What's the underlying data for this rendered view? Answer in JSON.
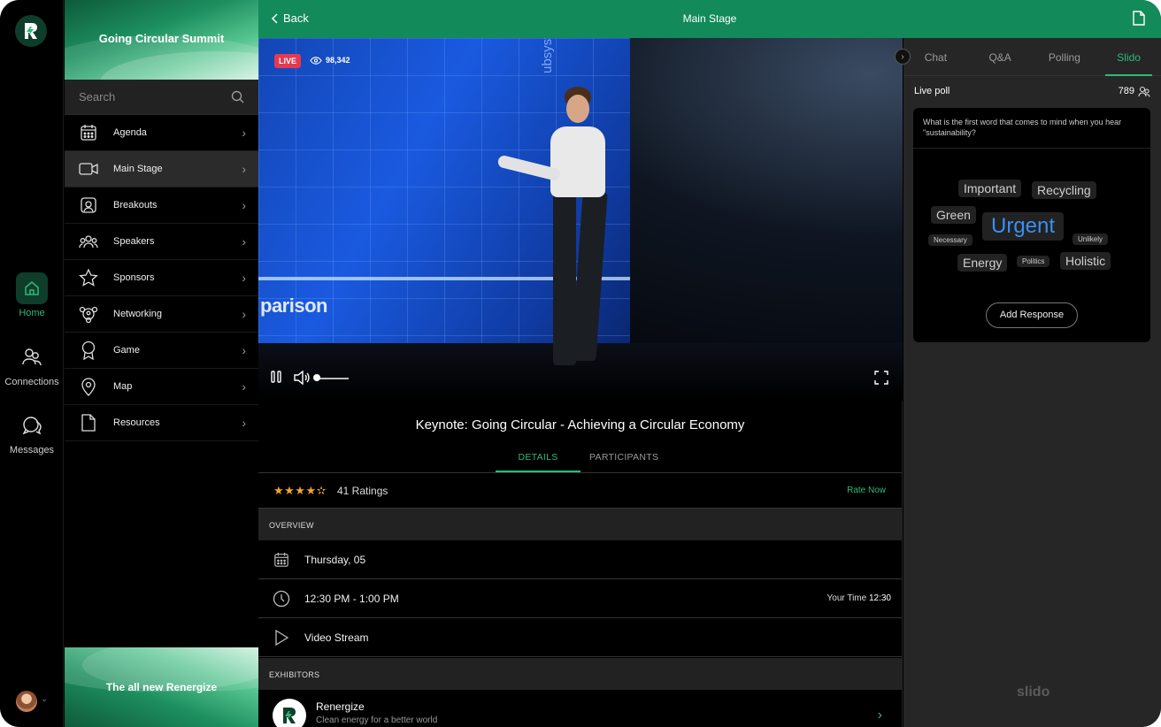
{
  "app": {
    "event_title": "Going Circular Summit",
    "promo_title": "The all new Renergize"
  },
  "rail": {
    "items": [
      {
        "label": "Home",
        "icon": "home-icon",
        "active": true
      },
      {
        "label": "Connections",
        "icon": "people-icon",
        "active": false
      },
      {
        "label": "Messages",
        "icon": "chat-icon",
        "active": false
      }
    ]
  },
  "nav": {
    "search_placeholder": "Search",
    "items": [
      {
        "label": "Agenda",
        "icon": "calendar-icon"
      },
      {
        "label": "Main Stage",
        "icon": "video-icon",
        "active": true
      },
      {
        "label": "Breakouts",
        "icon": "breakout-icon"
      },
      {
        "label": "Speakers",
        "icon": "speakers-icon"
      },
      {
        "label": "Sponsors",
        "icon": "star-icon"
      },
      {
        "label": "Networking",
        "icon": "network-icon"
      },
      {
        "label": "Game",
        "icon": "award-icon"
      },
      {
        "label": "Map",
        "icon": "map-pin-icon"
      },
      {
        "label": "Resources",
        "icon": "document-icon"
      }
    ]
  },
  "header": {
    "back_label": "Back",
    "title": "Main Stage"
  },
  "video": {
    "live_label": "LIVE",
    "viewers": "98,342",
    "screen_word": "parison",
    "screen_vertical": "ubsystem",
    "volume_level": 0.05
  },
  "session": {
    "title": "Keynote: Going Circular - Achieving a Circular Economy",
    "tabs": [
      "DETAILS",
      "PARTICIPANTS"
    ],
    "stars": "★★★★✫",
    "rating_value": 4.5,
    "ratings_label": "41 Ratings",
    "rate_now": "Rate Now",
    "overview_header": "OVERVIEW",
    "date": "Thursday, 05",
    "time": "12:30 PM - 1:00 PM",
    "your_time_label": "Your Time",
    "your_time_value": "12:30",
    "stream": "Video Stream",
    "exhibitors_header": "EXHIBITORS",
    "exhibitor_name": "Renergize",
    "exhibitor_tagline": "Clean energy for a better world"
  },
  "slido": {
    "tabs": [
      "Chat",
      "Q&A",
      "Polling",
      "Slido"
    ],
    "active_tab": "Slido",
    "live_poll_label": "Live poll",
    "participants": "789",
    "question": "What is the first word that comes to mind when you hear \"sustainability?",
    "words": [
      "Important",
      "Recycling",
      "Green",
      "Urgent",
      "Necessary",
      "Unlikely",
      "Energy",
      "Politics",
      "Holistic"
    ],
    "add_response": "Add Response",
    "brand": "slido",
    "accent_color": "#2fb87a",
    "highlight_color": "#3b8ff0"
  }
}
